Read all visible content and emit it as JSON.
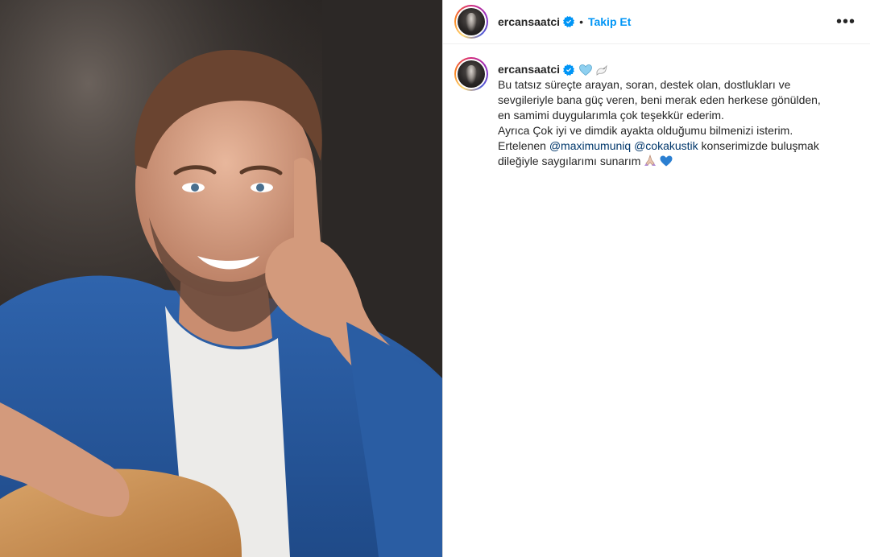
{
  "post": {
    "header": {
      "username": "ercansaatci",
      "separator": "•",
      "follow_label": "Takip Et",
      "more_label": "•••"
    },
    "caption": {
      "username": "ercansaatci",
      "lines": [
        "Bu tatsız süreçte arayan, soran, destek olan, dostlukları ve",
        "sevgileriyle bana güç veren, beni merak eden herkese gönülden,",
        "en samimi duygularımla çok teşekkür ederim.",
        "Ayrıca Çok iyi ve dimdik ayakta olduğumu bilmenizi isterim."
      ],
      "line5_prefix": "Ertelenen",
      "mention1": "@maximumuniq",
      "mention2": "@cokakustik",
      "line5_suffix": "konserimizde buluşmak",
      "line6_text": "dileğiyle saygılarımı sunarım"
    },
    "colors": {
      "follow": "#0095f6",
      "mention": "#00376b",
      "verified": "#0095f6",
      "text": "#262626"
    },
    "icons": {
      "verified": "verified-badge-icon",
      "heart": "light-blue-heart-icon",
      "dove": "dove-icon",
      "hands": "praying-hands-icon",
      "blue_heart": "blue-heart-icon",
      "more": "more-options-icon"
    }
  }
}
